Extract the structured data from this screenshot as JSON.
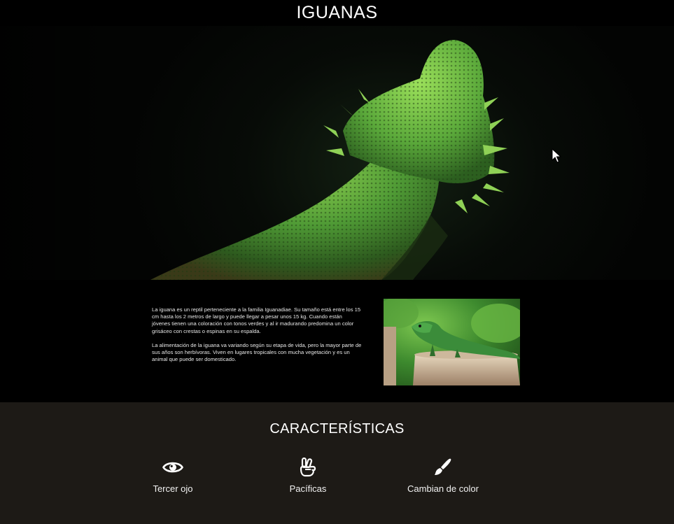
{
  "header": {
    "title": "IGUANAS"
  },
  "intro": {
    "paragraphs": [
      "La iguana es un reptil perteneciente a la familia Iguanadiae. Su tamaño está entre los 15 cm hasta los 2 metros de largo y puede llegar a pesar unos 15 kg. Cuando están jóvenes tienen una coloración con tonos verdes y al ir madurando predomina un color grisáceo con crestas o espinas en su espalda.",
      "La alimentación de la iguana va variando según su etapa de vida, pero la mayor parte de sus años son herbívoras. Viven en lugares tropicales con mucha vegetación y es un animal que puede ser domesticado."
    ]
  },
  "features": {
    "title": "CARACTERÍSTICAS",
    "items": [
      {
        "label": "Tercer ojo",
        "icon": "eye-icon"
      },
      {
        "label": "Pacíficas",
        "icon": "peace-hand-icon"
      },
      {
        "label": "Cambian de color",
        "icon": "paint-brush-icon"
      }
    ]
  },
  "colors": {
    "header_bg": "#000000",
    "features_bg": "#1d1a16",
    "iguana_green": "#4f9a35"
  }
}
